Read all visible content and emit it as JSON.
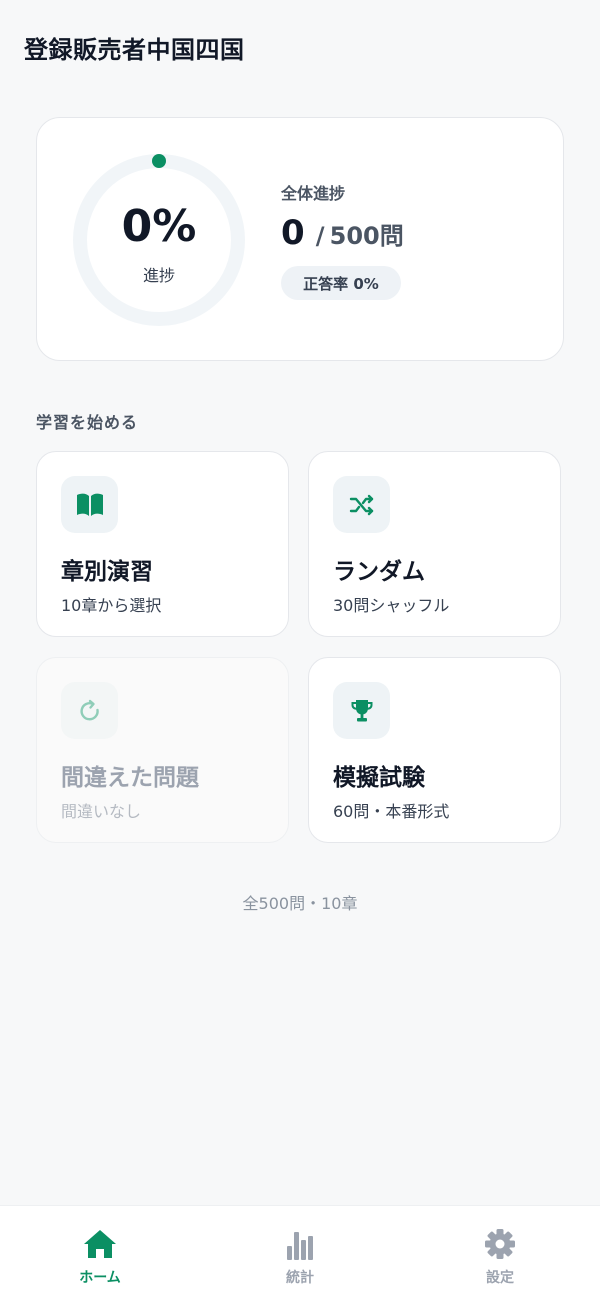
{
  "app": {
    "title": "登録販売者中国四国"
  },
  "progress": {
    "percent_text": "0%",
    "percent_value": 0,
    "caption": "進捗",
    "overall_label": "全体進捗",
    "answered": "0",
    "separator": "/",
    "total": "500問",
    "accuracy": "正答率 0%"
  },
  "section": {
    "heading": "学習を始める"
  },
  "modes": [
    {
      "title": "章別演習",
      "subtitle": "10章から選択",
      "icon": "book-icon",
      "enabled": true
    },
    {
      "title": "ランダム",
      "subtitle": "30問シャッフル",
      "icon": "shuffle-icon",
      "enabled": true
    },
    {
      "title": "間違えた問題",
      "subtitle": "間違いなし",
      "icon": "retry-icon",
      "enabled": false
    },
    {
      "title": "模擬試験",
      "subtitle": "60問・本番形式",
      "icon": "trophy-icon",
      "enabled": true
    }
  ],
  "footer": {
    "note": "全500問・10章"
  },
  "nav": {
    "items": [
      {
        "label": "ホーム",
        "icon": "home-icon",
        "active": true
      },
      {
        "label": "統計",
        "icon": "stats-icon",
        "active": false
      },
      {
        "label": "設定",
        "icon": "gear-icon",
        "active": false
      }
    ]
  },
  "colors": {
    "accent": "#0b8f63",
    "background": "#f7f8f9",
    "card": "#ffffff",
    "ring_track": "#f1f5f8",
    "text": "#111827",
    "muted": "#9ca3af"
  }
}
